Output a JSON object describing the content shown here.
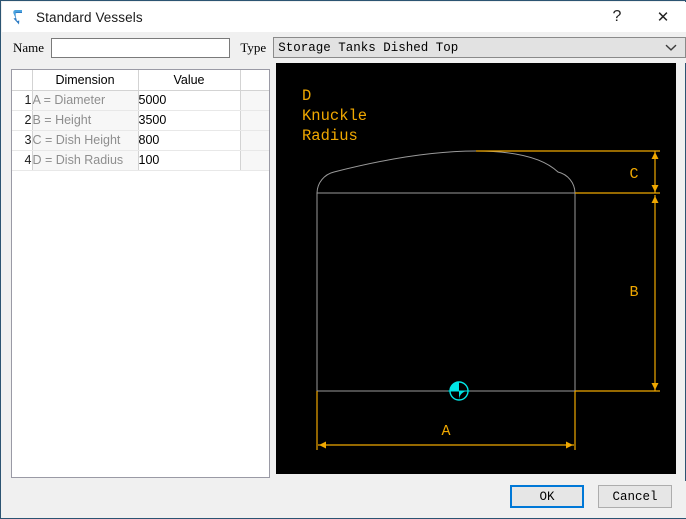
{
  "window": {
    "title": "Standard Vessels",
    "icon": "vessel-app-icon",
    "help_label": "?",
    "close_label": "✕"
  },
  "form": {
    "name_label": "Name",
    "name_value": "",
    "name_placeholder": "",
    "type_label": "Type",
    "type_value": "Storage Tanks Dished Top",
    "type_options": [
      "Storage Tanks Dished Top"
    ]
  },
  "table": {
    "headers": [
      "",
      "Dimension",
      "Value",
      ""
    ],
    "rows": [
      {
        "index": "1",
        "dimension": "A = Diameter",
        "value": "5000"
      },
      {
        "index": "2",
        "dimension": "B = Height",
        "value": "3500"
      },
      {
        "index": "3",
        "dimension": "C = Dish Height",
        "value": "800"
      },
      {
        "index": "4",
        "dimension": "D = Dish Radius",
        "value": "100"
      }
    ]
  },
  "drawing": {
    "background": "#000000",
    "outline_color": "#9a9a9a",
    "dimension_color": "#f0a800",
    "origin_color": "#00e5e5",
    "annotation_lines": [
      "D",
      "Knuckle",
      "Radius"
    ],
    "labels": {
      "a": "A",
      "b": "B",
      "c": "C"
    }
  },
  "buttons": {
    "ok": "OK",
    "cancel": "Cancel"
  }
}
